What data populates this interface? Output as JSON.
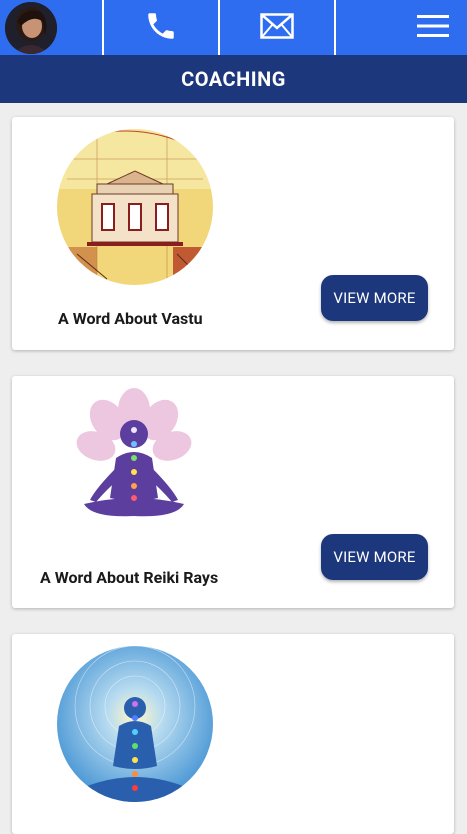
{
  "header": {
    "title": "COACHING",
    "icons": {
      "phone": "phone-icon",
      "mail": "mail-icon",
      "menu": "hamburger-menu-icon"
    },
    "colors": {
      "topbar": "#2f6df0",
      "title_bar": "#1c377c",
      "button": "#1c377c"
    }
  },
  "cards": [
    {
      "title": "A Word About Vastu",
      "button_label": "VIEW MORE"
    },
    {
      "title": "A Word About Reiki Rays",
      "button_label": "VIEW MORE"
    },
    {
      "title": "",
      "button_label": ""
    }
  ]
}
